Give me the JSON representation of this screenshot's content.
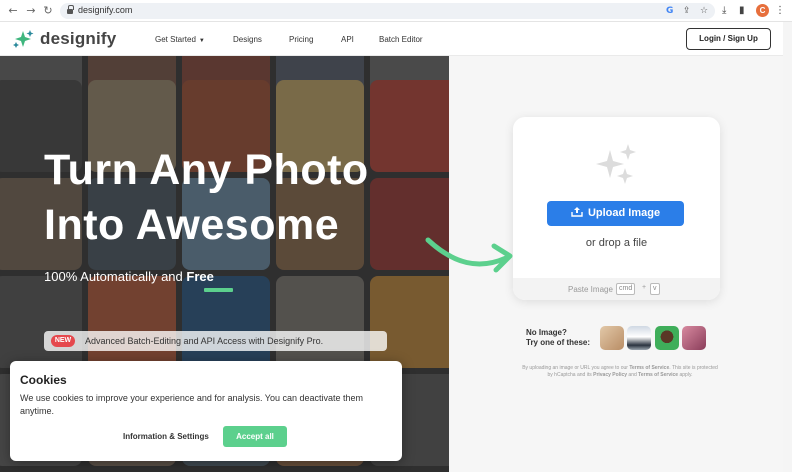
{
  "browser": {
    "url": "designify.com",
    "profile_initial": "C",
    "icons": [
      "back-arrow-icon",
      "forward-arrow-icon",
      "reload-icon",
      "lock-icon",
      "google-icon",
      "share-icon",
      "star-icon",
      "download-icon",
      "sidepanel-icon",
      "menu-dots-icon"
    ]
  },
  "header": {
    "logo_text": "designify",
    "nav": [
      {
        "label": "Get Started"
      },
      {
        "label": "Designs"
      },
      {
        "label": "Pricing"
      },
      {
        "label": "API"
      },
      {
        "label": "Batch Editor"
      }
    ],
    "login_label": "Login / Sign Up"
  },
  "hero": {
    "title_line1": "Turn Any Photo",
    "title_line2": "Into Awesome",
    "subtitle_prefix": "100% Automatically and",
    "subtitle_emphasis": "Free",
    "pro_badge": "NEW",
    "pro_text": "Advanced Batch-Editing and API Access with Designify Pro."
  },
  "upload": {
    "button_label": "Upload Image",
    "drop_text": "or drop a file",
    "paste_label": "Paste Image",
    "key_cmd": "cmd",
    "key_plus": "+",
    "key_v": "v",
    "no_image_line1": "No Image?",
    "no_image_line2": "Try one of these:",
    "disclaimer_prefix": "By uploading an image or URL you agree to our",
    "disclaimer_tos": "Terms of Service",
    "disclaimer_mid": ". This site is protected by hCaptcha and its",
    "disclaimer_privacy": "Privacy Policy",
    "disclaimer_and": "and",
    "disclaimer_tos2": "Terms of Service",
    "disclaimer_suffix": "apply."
  },
  "cookie": {
    "title": "Cookies",
    "text": "We use cookies to improve your experience and for analysis. You can deactivate them anytime.",
    "info_label": "Information & Settings",
    "accept_label": "Accept all"
  },
  "colors": {
    "accent_green": "#5cd08d",
    "upload_blue": "#2b7ee8",
    "new_badge_red": "#e5484d"
  }
}
